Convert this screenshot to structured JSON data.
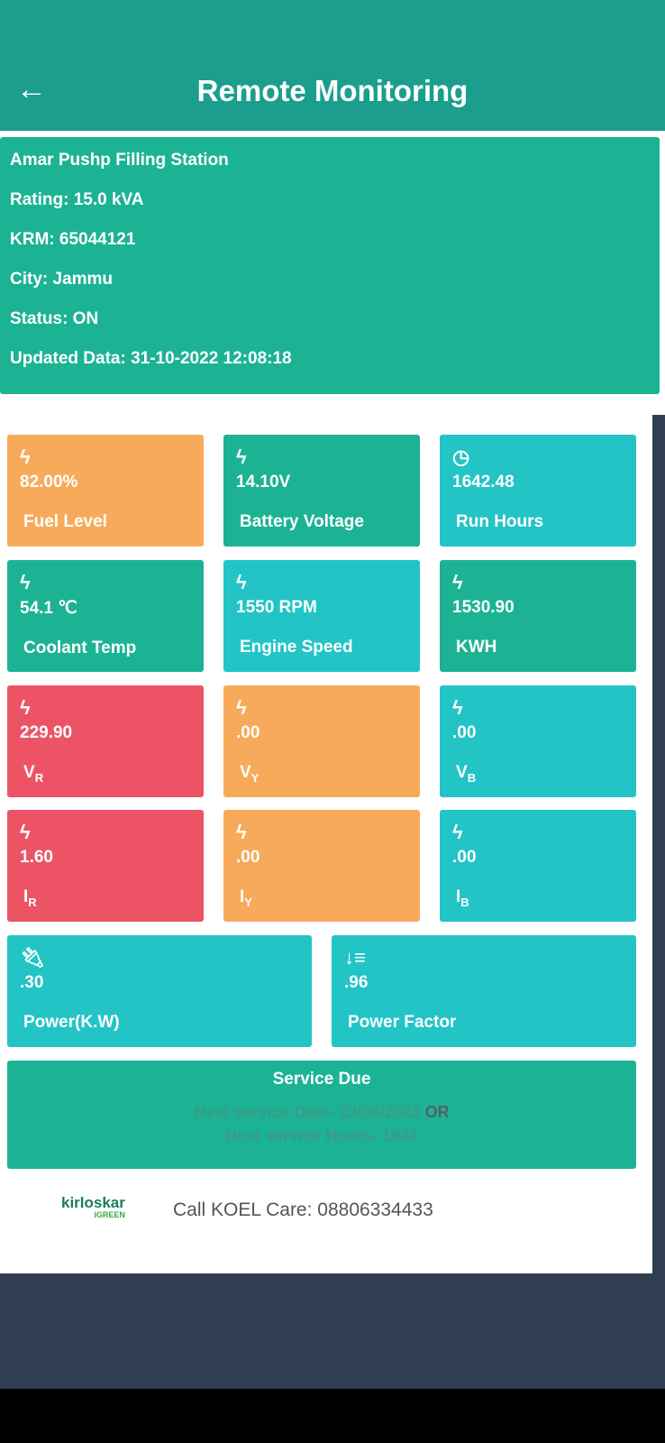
{
  "header": {
    "title": "Remote Monitoring",
    "back_icon": "arrow-left-icon"
  },
  "info": {
    "name": "Amar Pushp Filling Station",
    "rating": "Rating: 15.0 kVA",
    "krm": "KRM: 65044121",
    "city": "City: Jammu",
    "status": "Status: ON",
    "updated": "Updated Data: 31-10-2022 12:08:18"
  },
  "tiles": [
    {
      "value": "82.00%",
      "label": "Fuel Level",
      "icon": "bolt-icon",
      "color": "#f7aa5a"
    },
    {
      "value": "14.10V",
      "label": "Battery Voltage",
      "icon": "bolt-icon",
      "color": "#1cb394"
    },
    {
      "value": "1642.48",
      "label": "Run Hours",
      "icon": "clock-icon",
      "color": "#23c4c6"
    },
    {
      "value": "54.1 ℃",
      "label": "Coolant Temp",
      "icon": "bolt-icon",
      "color": "#1cb394"
    },
    {
      "value": "1550 RPM",
      "label": "Engine Speed",
      "icon": "bolt-icon",
      "color": "#23c4c6"
    },
    {
      "value": "1530.90",
      "label": "KWH",
      "icon": "bolt-icon",
      "color": "#1cb394"
    },
    {
      "value": "229.90",
      "label": "V",
      "sub": "R",
      "icon": "bolt-icon",
      "color": "#ec5466"
    },
    {
      "value": ".00",
      "label": "V",
      "sub": "Y",
      "icon": "bolt-icon",
      "color": "#f7aa5a"
    },
    {
      "value": ".00",
      "label": "V",
      "sub": "B",
      "icon": "bolt-icon",
      "color": "#23c4c6"
    },
    {
      "value": "1.60",
      "label": "I",
      "sub": "R",
      "icon": "bolt-icon",
      "color": "#ec5466"
    },
    {
      "value": ".00",
      "label": "I",
      "sub": "Y",
      "icon": "bolt-icon",
      "color": "#f7aa5a"
    },
    {
      "value": ".00",
      "label": "I",
      "sub": "B",
      "icon": "bolt-icon",
      "color": "#23c4c6"
    },
    {
      "value": ".30",
      "label": "Power(K.W)",
      "icon": "plug-icon",
      "color": "#23c4c6"
    },
    {
      "value": ".96",
      "label": "Power Factor",
      "icon": "sort-amount-down-icon",
      "color": "#23c4c6"
    }
  ],
  "service": {
    "title": "Service Due",
    "date_line": "Next service Date- 23/06/2023",
    "or": "OR",
    "hours_line": "Next service Hours- 1947"
  },
  "footer": {
    "logo": "kirloskar",
    "logo_sub": "iGREEN",
    "care": "Call KOEL Care: 08806334433"
  }
}
